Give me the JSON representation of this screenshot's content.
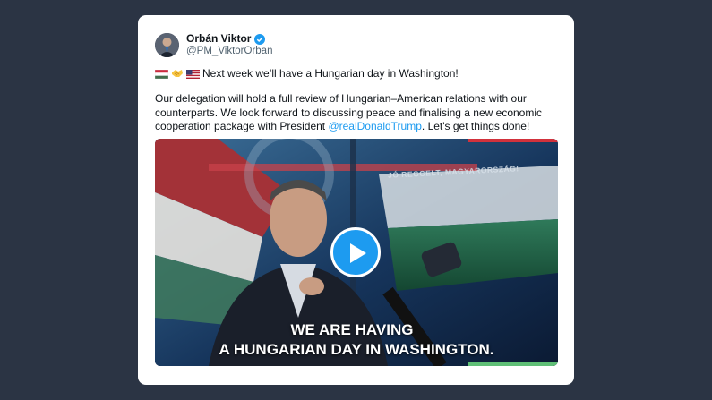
{
  "tweet": {
    "author": {
      "name": "Orbán Viktor",
      "handle": "@PM_ViktorOrban",
      "verified": true
    },
    "line1": {
      "icons": [
        "hungary-flag-icon",
        "handshake-icon",
        "usa-flag-icon"
      ],
      "text": "Next week we’ll have a Hungarian day in Washington!"
    },
    "paragraph": {
      "text_before": "Our delegation will hold a full review of Hungarian–American relations with our counterparts. We look forward to discussing peace and finalising a new economic cooperation package with President ",
      "mention": "@realDonaldTrump",
      "text_after": ". Let's get things done!"
    },
    "media": {
      "overlay_text": "JÓ REGGELT, MAGYARORSZÁG!",
      "caption_line1": "WE ARE HAVING",
      "caption_line2": "A HUNGARIAN DAY IN WASHINGTON.",
      "play_icon": "play-icon"
    }
  },
  "colors": {
    "background": "#2b3444",
    "card": "#ffffff",
    "accent": "#1d9bf0",
    "text": "#0f1419",
    "muted": "#536471"
  }
}
